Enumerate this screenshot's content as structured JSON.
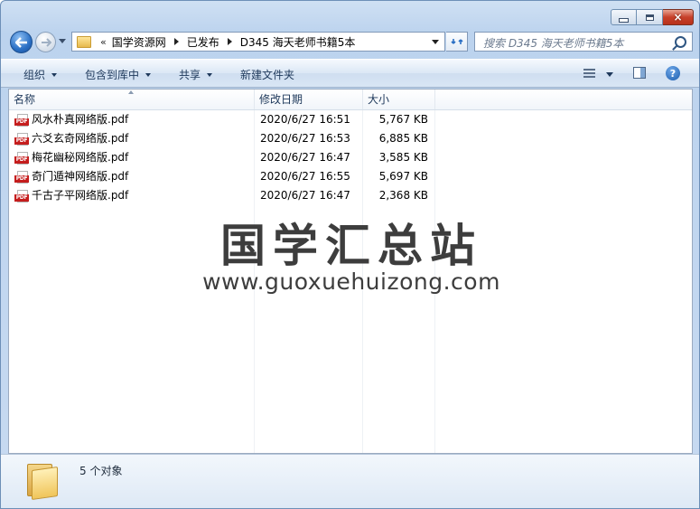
{
  "window": {
    "caption_buttons": {
      "minimize": "minimize",
      "maximize": "maximize",
      "close": "×"
    }
  },
  "nav": {
    "overflow_chevron": "«",
    "breadcrumbs": [
      "国学资源网",
      "已发布",
      "D345 海天老师书籍5本"
    ],
    "search_placeholder": "搜索 D345 海天老师书籍5本"
  },
  "toolbar": {
    "organize": "组织",
    "include_in_library": "包含到库中",
    "share": "共享",
    "new_folder": "新建文件夹",
    "help": "?"
  },
  "columns": {
    "name": "名称",
    "modified": "修改日期",
    "size": "大小"
  },
  "files": [
    {
      "name": "风水朴真网络版.pdf",
      "modified": "2020/6/27 16:51",
      "size": "5,767 KB",
      "icon": "pdf-icon"
    },
    {
      "name": "六爻玄奇网络版.pdf",
      "modified": "2020/6/27 16:53",
      "size": "6,885 KB",
      "icon": "pdf-icon"
    },
    {
      "name": "梅花幽秘网络版.pdf",
      "modified": "2020/6/27 16:47",
      "size": "3,585 KB",
      "icon": "pdf-icon"
    },
    {
      "name": "奇门遁神网络版.pdf",
      "modified": "2020/6/27 16:55",
      "size": "5,697 KB",
      "icon": "pdf-icon"
    },
    {
      "name": "千古子平网络版.pdf",
      "modified": "2020/6/27 16:47",
      "size": "2,368 KB",
      "icon": "pdf-icon"
    }
  ],
  "watermark": {
    "title": "国学汇总站",
    "url": "www.guoxuehuizong.com"
  },
  "status": {
    "item_count": "5 个对象"
  },
  "icons": {
    "pdf_badge": "PDF"
  },
  "colors": {
    "pdf_red": "#c51d1d",
    "accent_blue": "#2a6fc4"
  }
}
